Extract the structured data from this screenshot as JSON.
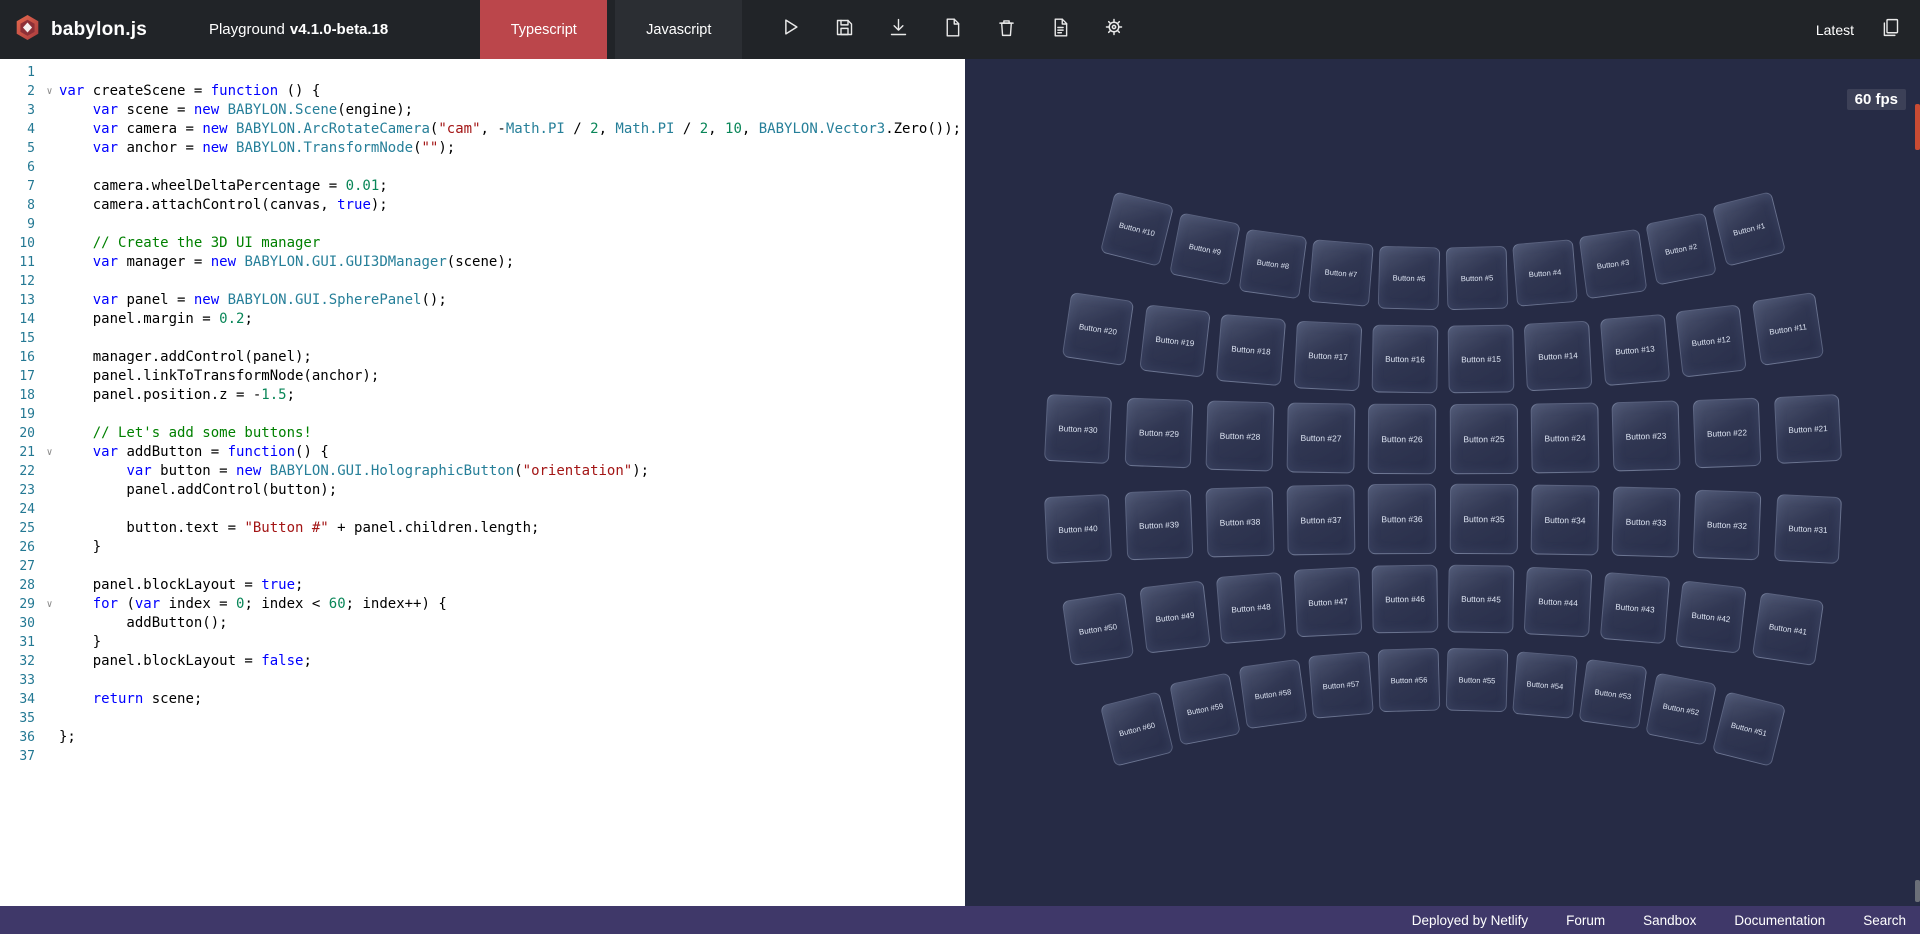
{
  "header": {
    "brand": "babylon.js",
    "product": "Playground",
    "version": "v4.1.0-beta.18",
    "tabs": [
      {
        "label": "Typescript",
        "active": true
      },
      {
        "label": "Javascript",
        "active": false
      }
    ],
    "latest_label": "Latest"
  },
  "editor": {
    "lines": [
      {
        "n": 1,
        "t": []
      },
      {
        "n": 2,
        "fold": true,
        "t": [
          [
            "k",
            "var"
          ],
          [
            "d",
            " createScene = "
          ],
          [
            "k",
            "function"
          ],
          [
            "d",
            " () {"
          ]
        ]
      },
      {
        "n": 3,
        "t": [
          [
            "d",
            "    "
          ],
          [
            "k",
            "var"
          ],
          [
            "d",
            " scene = "
          ],
          [
            "k",
            "new"
          ],
          [
            "d",
            " "
          ],
          [
            "t",
            "BABYLON.Scene"
          ],
          [
            "d",
            "(engine);"
          ]
        ]
      },
      {
        "n": 4,
        "t": [
          [
            "d",
            "    "
          ],
          [
            "k",
            "var"
          ],
          [
            "d",
            " camera = "
          ],
          [
            "k",
            "new"
          ],
          [
            "d",
            " "
          ],
          [
            "t",
            "BABYLON.ArcRotateCamera"
          ],
          [
            "d",
            "("
          ],
          [
            "s",
            "\"cam\""
          ],
          [
            "d",
            ", -"
          ],
          [
            "t",
            "Math.PI"
          ],
          [
            "d",
            " / "
          ],
          [
            "n",
            "2"
          ],
          [
            "d",
            ", "
          ],
          [
            "t",
            "Math.PI"
          ],
          [
            "d",
            " / "
          ],
          [
            "n",
            "2"
          ],
          [
            "d",
            ", "
          ],
          [
            "n",
            "10"
          ],
          [
            "d",
            ", "
          ],
          [
            "t",
            "BABYLON.Vector3"
          ],
          [
            "d",
            ".Zero());"
          ]
        ]
      },
      {
        "n": 5,
        "t": [
          [
            "d",
            "    "
          ],
          [
            "k",
            "var"
          ],
          [
            "d",
            " anchor = "
          ],
          [
            "k",
            "new"
          ],
          [
            "d",
            " "
          ],
          [
            "t",
            "BABYLON.TransformNode"
          ],
          [
            "d",
            "("
          ],
          [
            "s",
            "\"\""
          ],
          [
            "d",
            ");"
          ]
        ]
      },
      {
        "n": 6,
        "t": []
      },
      {
        "n": 7,
        "t": [
          [
            "d",
            "    camera.wheelDeltaPercentage = "
          ],
          [
            "n",
            "0.01"
          ],
          [
            "d",
            ";"
          ]
        ]
      },
      {
        "n": 8,
        "t": [
          [
            "d",
            "    camera.attachControl(canvas, "
          ],
          [
            "k",
            "true"
          ],
          [
            "d",
            ");"
          ]
        ]
      },
      {
        "n": 9,
        "t": []
      },
      {
        "n": 10,
        "t": [
          [
            "d",
            "    "
          ],
          [
            "c",
            "// Create the 3D UI manager"
          ]
        ]
      },
      {
        "n": 11,
        "t": [
          [
            "d",
            "    "
          ],
          [
            "k",
            "var"
          ],
          [
            "d",
            " manager = "
          ],
          [
            "k",
            "new"
          ],
          [
            "d",
            " "
          ],
          [
            "t",
            "BABYLON.GUI.GUI3DManager"
          ],
          [
            "d",
            "(scene);"
          ]
        ]
      },
      {
        "n": 12,
        "t": []
      },
      {
        "n": 13,
        "t": [
          [
            "d",
            "    "
          ],
          [
            "k",
            "var"
          ],
          [
            "d",
            " panel = "
          ],
          [
            "k",
            "new"
          ],
          [
            "d",
            " "
          ],
          [
            "t",
            "BABYLON.GUI.SpherePanel"
          ],
          [
            "d",
            "();"
          ]
        ]
      },
      {
        "n": 14,
        "t": [
          [
            "d",
            "    panel.margin = "
          ],
          [
            "n",
            "0.2"
          ],
          [
            "d",
            ";"
          ]
        ]
      },
      {
        "n": 15,
        "t": []
      },
      {
        "n": 16,
        "t": [
          [
            "d",
            "    manager.addControl(panel);"
          ]
        ]
      },
      {
        "n": 17,
        "t": [
          [
            "d",
            "    panel.linkToTransformNode(anchor);"
          ]
        ]
      },
      {
        "n": 18,
        "t": [
          [
            "d",
            "    panel.position.z = -"
          ],
          [
            "n",
            "1.5"
          ],
          [
            "d",
            ";"
          ]
        ]
      },
      {
        "n": 19,
        "t": []
      },
      {
        "n": 20,
        "t": [
          [
            "d",
            "    "
          ],
          [
            "c",
            "// Let's add some buttons!"
          ]
        ]
      },
      {
        "n": 21,
        "fold": true,
        "t": [
          [
            "d",
            "    "
          ],
          [
            "k",
            "var"
          ],
          [
            "d",
            " addButton = "
          ],
          [
            "k",
            "function"
          ],
          [
            "d",
            "() {"
          ]
        ]
      },
      {
        "n": 22,
        "t": [
          [
            "d",
            "        "
          ],
          [
            "k",
            "var"
          ],
          [
            "d",
            " button = "
          ],
          [
            "k",
            "new"
          ],
          [
            "d",
            " "
          ],
          [
            "t",
            "BABYLON.GUI.HolographicButton"
          ],
          [
            "d",
            "("
          ],
          [
            "s",
            "\"orientation\""
          ],
          [
            "d",
            ");"
          ]
        ]
      },
      {
        "n": 23,
        "t": [
          [
            "d",
            "        panel.addControl(button);"
          ]
        ]
      },
      {
        "n": 24,
        "t": []
      },
      {
        "n": 25,
        "t": [
          [
            "d",
            "        button.text = "
          ],
          [
            "s",
            "\"Button #\""
          ],
          [
            "d",
            " + panel.children.length;"
          ]
        ]
      },
      {
        "n": 26,
        "t": [
          [
            "d",
            "    }"
          ]
        ]
      },
      {
        "n": 27,
        "t": []
      },
      {
        "n": 28,
        "t": [
          [
            "d",
            "    panel.blockLayout = "
          ],
          [
            "k",
            "true"
          ],
          [
            "d",
            ";"
          ]
        ]
      },
      {
        "n": 29,
        "fold": true,
        "t": [
          [
            "d",
            "    "
          ],
          [
            "k",
            "for"
          ],
          [
            "d",
            " ("
          ],
          [
            "k",
            "var"
          ],
          [
            "d",
            " index = "
          ],
          [
            "n",
            "0"
          ],
          [
            "d",
            "; index < "
          ],
          [
            "n",
            "60"
          ],
          [
            "d",
            "; index++) {"
          ]
        ]
      },
      {
        "n": 30,
        "t": [
          [
            "d",
            "        addButton();"
          ]
        ]
      },
      {
        "n": 31,
        "t": [
          [
            "d",
            "    }"
          ]
        ]
      },
      {
        "n": 32,
        "t": [
          [
            "d",
            "    panel.blockLayout = "
          ],
          [
            "k",
            "false"
          ],
          [
            "d",
            ";"
          ]
        ]
      },
      {
        "n": 33,
        "t": []
      },
      {
        "n": 34,
        "t": [
          [
            "d",
            "    "
          ],
          [
            "k",
            "return"
          ],
          [
            "d",
            " scene;"
          ]
        ]
      },
      {
        "n": 35,
        "t": []
      },
      {
        "n": 36,
        "t": [
          [
            "d",
            "};"
          ]
        ]
      },
      {
        "n": 37,
        "t": []
      }
    ]
  },
  "canvas": {
    "fps_label": "60 fps",
    "buttons": [
      "Button #1",
      "Button #2",
      "Button #3",
      "Button #4",
      "Button #5",
      "Button #6",
      "Button #7",
      "Button #8",
      "Button #9",
      "Button #10",
      "Button #11",
      "Button #12",
      "Button #13",
      "Button #14",
      "Button #15",
      "Button #16",
      "Button #17",
      "Button #18",
      "Button #19",
      "Button #20",
      "Button #21",
      "Button #22",
      "Button #23",
      "Button #24",
      "Button #25",
      "Button #26",
      "Button #27",
      "Button #28",
      "Button #29",
      "Button #30",
      "Button #31",
      "Button #32",
      "Button #33",
      "Button #34",
      "Button #35",
      "Button #36",
      "Button #37",
      "Button #38",
      "Button #39",
      "Button #40",
      "Button #41",
      "Button #42",
      "Button #43",
      "Button #44",
      "Button #45",
      "Button #46",
      "Button #47",
      "Button #48",
      "Button #49",
      "Button #50",
      "Button #51",
      "Button #52",
      "Button #53",
      "Button #54",
      "Button #55",
      "Button #56",
      "Button #57",
      "Button #58",
      "Button #59",
      "Button #60"
    ]
  },
  "footer": {
    "items": [
      "Deployed by Netlify",
      "Forum",
      "Sandbox",
      "Documentation",
      "Search"
    ]
  },
  "colors": {
    "accent_red": "#bb464b",
    "header_bg": "#212428",
    "canvas_bg": "#262b45",
    "footer_purple": "#3f3869",
    "scroll_thumb_orange": "#c94b33",
    "keyword": "#0000ff",
    "string": "#a31515",
    "comment": "#008000",
    "number": "#098658",
    "type": "#267f99"
  }
}
